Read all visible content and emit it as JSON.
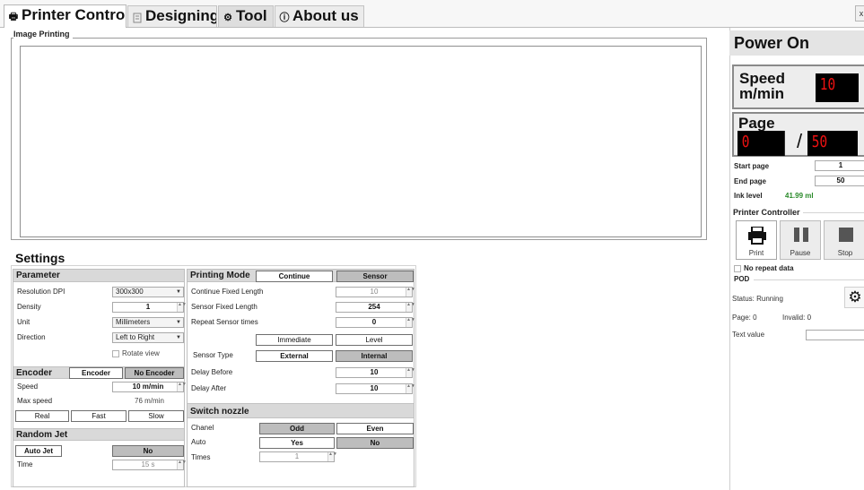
{
  "tabs": [
    {
      "label": "Printer Control",
      "icon": "printer-icon"
    },
    {
      "label": "Designing",
      "icon": "design-icon"
    },
    {
      "label": "Tool",
      "icon": "gears-icon"
    },
    {
      "label": "About us",
      "icon": "info-icon"
    }
  ],
  "close_label": "x",
  "image_printing": {
    "label": "Image Printing"
  },
  "settings": {
    "title": "Settings"
  },
  "parameter": {
    "header": "Parameter",
    "resolution_label": "Resolution DPI",
    "resolution_value": "300x300",
    "density_label": "Density",
    "density_value": "1",
    "unit_label": "Unit",
    "unit_value": "Millimeters",
    "direction_label": "Direction",
    "direction_value": "Left to Right",
    "rotate_label": "Rotate view"
  },
  "encoder": {
    "header": "Encoder",
    "encoder_btn": "Encoder",
    "no_encoder_btn": "No Encoder",
    "speed_label": "Speed",
    "speed_value": "10 m/min",
    "max_speed_label": "Max speed",
    "max_speed_value": "76 m/min",
    "real": "Real",
    "fast": "Fast",
    "slow": "Slow"
  },
  "random_jet": {
    "header": "Random Jet",
    "auto_jet": "Auto Jet",
    "no": "No",
    "time_label": "Time",
    "time_value": "15 s"
  },
  "printing_mode": {
    "header": "Printing Mode",
    "continue_btn": "Continue",
    "sensor_btn": "Sensor",
    "cont_fixed_label": "Continue Fixed Length",
    "cont_fixed_value": "10",
    "sensor_fixed_label": "Sensor Fixed Length",
    "sensor_fixed_value": "254",
    "repeat_label": "Repeat Sensor times",
    "repeat_value": "0",
    "immediate": "Immediate",
    "level": "Level",
    "sensor_type_label": "Sensor Type",
    "external": "External",
    "internal": "Internal",
    "delay_before_label": "Delay Before",
    "delay_before_value": "10",
    "delay_after_label": "Delay After",
    "delay_after_value": "10"
  },
  "switch_nozzle": {
    "header": "Switch nozzle",
    "chanel_label": "Chanel",
    "odd": "Odd",
    "even": "Even",
    "auto_label": "Auto",
    "yes": "Yes",
    "no": "No",
    "times_label": "Times",
    "times_value": "1"
  },
  "right": {
    "power": "Power On",
    "speed_label_1": "Speed",
    "speed_label_2": "m/min",
    "speed_value": "10",
    "page_label": "Page",
    "page_current": "0",
    "page_sep": "/",
    "page_total": "50",
    "start_page_label": "Start page",
    "start_page_value": "1",
    "end_page_label": "End page",
    "end_page_value": "50",
    "ink_label": "Ink level",
    "ink_value": "41.99 ml",
    "ink_color": "#2a8a2a",
    "controller_label": "Printer Controller",
    "print": "Print",
    "pause": "Pause",
    "stop": "Stop",
    "no_repeat_label": "No repeat data",
    "pod_label": "POD",
    "status": "Status: Running",
    "page_info": "Page: 0",
    "invalid_info": "Invalid: 0",
    "text_value_label": "Text value"
  }
}
